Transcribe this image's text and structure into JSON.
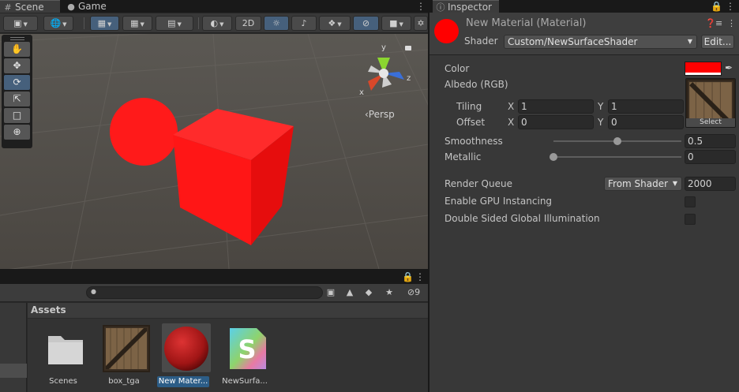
{
  "scene_panel": {
    "tabs": [
      {
        "label": "Scene",
        "icon": "grid-icon",
        "active": true
      },
      {
        "label": "Game",
        "icon": "gamepad-icon",
        "active": false
      }
    ],
    "toolbar": {
      "mode_2d_label": "2D"
    },
    "viewport": {
      "persp_label": "‹Persp",
      "gizmo_axes": {
        "x": "x",
        "y": "y",
        "z": "z"
      },
      "objects": [
        {
          "type": "sphere",
          "color": "#ff1a1a"
        },
        {
          "type": "cube",
          "color": "#ff1a1a"
        }
      ]
    },
    "tools": [
      "hand-tool-icon",
      "move-tool-icon",
      "rotate-tool-icon",
      "scale-tool-icon",
      "rect-tool-icon",
      "transform-tool-icon"
    ],
    "active_tool": "rotate-tool-icon"
  },
  "project_panel": {
    "search": {
      "value": "",
      "placeholder": ""
    },
    "hidden_count": "9",
    "assets_header": "Assets",
    "assets": [
      {
        "label": "Scenes",
        "icon": "folder-icon",
        "selected": false
      },
      {
        "label": "box_tga",
        "icon": "texture-icon",
        "selected": false
      },
      {
        "label": "New Mater...",
        "icon": "material-icon",
        "selected": true
      },
      {
        "label": "NewSurfa...",
        "icon": "shader-icon",
        "selected": false
      }
    ]
  },
  "inspector": {
    "tab_label": "Inspector",
    "material_title": "New Material (Material)",
    "material_color": "#ff0000",
    "shader_label": "Shader",
    "shader_value": "Custom/NewSurfaceShader",
    "edit_label": "Edit...",
    "properties": {
      "color_label": "Color",
      "color_value": "#ff0000",
      "albedo_label": "Albedo (RGB)",
      "albedo_select": "Select",
      "tiling_label": "Tiling",
      "tiling_x": "1",
      "tiling_y": "1",
      "offset_label": "Offset",
      "offset_x": "0",
      "offset_y": "0",
      "axis_x": "X",
      "axis_y": "Y",
      "smoothness_label": "Smoothness",
      "smoothness_value": "0.5",
      "smoothness_fraction": 0.5,
      "metallic_label": "Metallic",
      "metallic_value": "0",
      "metallic_fraction": 0,
      "render_queue_label": "Render Queue",
      "render_queue_mode": "From Shader",
      "render_queue_value": "2000",
      "gpu_instancing_label": "Enable GPU Instancing",
      "gpu_instancing_checked": false,
      "double_sided_gi_label": "Double Sided Global Illumination",
      "double_sided_gi_checked": false
    }
  }
}
